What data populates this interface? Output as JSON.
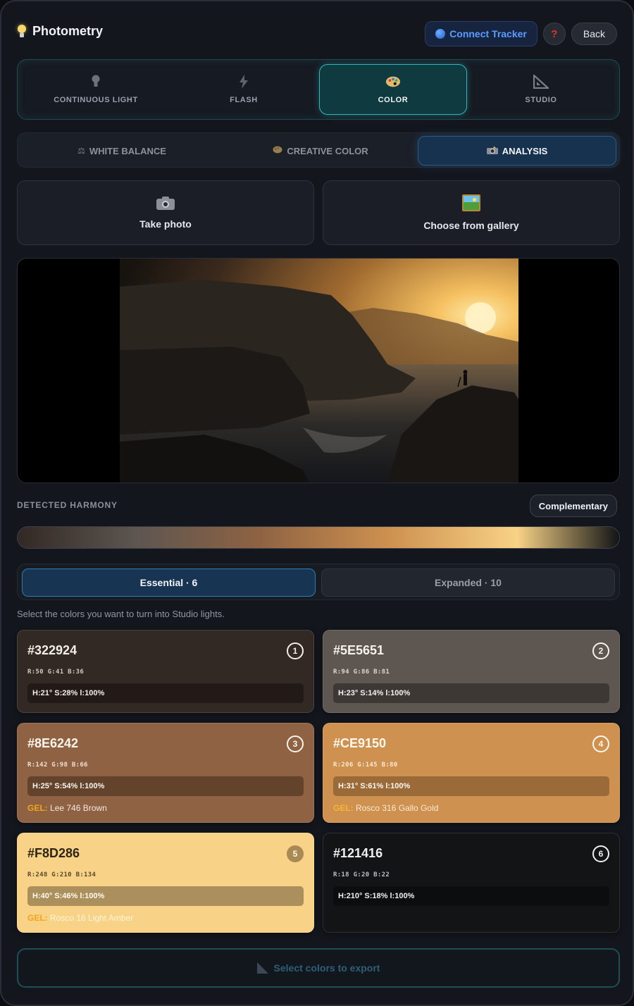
{
  "app": {
    "title": "Photometry"
  },
  "header": {
    "tracker_label": "Connect Tracker",
    "help_label": "?",
    "back_label": "Back"
  },
  "main_tabs": [
    {
      "label": "CONTINUOUS LIGHT",
      "icon": "bulb-icon"
    },
    {
      "label": "FLASH",
      "icon": "bolt-icon"
    },
    {
      "label": "COLOR",
      "icon": "palette-icon",
      "active": true
    },
    {
      "label": "STUDIO",
      "icon": "triangle-ruler-icon"
    }
  ],
  "sub_tabs": [
    {
      "label": "WHITE BALANCE",
      "icon": "scale-icon"
    },
    {
      "label": "CREATIVE COLOR",
      "icon": "palette-icon"
    },
    {
      "label": "ANALYSIS",
      "icon": "camera-flash-icon",
      "active": true
    }
  ],
  "capture": {
    "take_photo": "Take photo",
    "gallery": "Choose from gallery"
  },
  "harmony": {
    "label": "DETECTED HARMONY",
    "value": "Complementary"
  },
  "modes": {
    "essential": "Essential · 6",
    "expanded": "Expanded · 10",
    "active": "essential"
  },
  "hint": "Select the colors you want to turn into Studio lights.",
  "gel_key": "GEL:",
  "colors": [
    {
      "num": "1",
      "hex": "#322924",
      "rgb": "R:50  G:41  B:36",
      "hsl": "H:21° S:28% l:100%",
      "gel": ""
    },
    {
      "num": "2",
      "hex": "#5E5651",
      "rgb": "R:94  G:86  B:81",
      "hsl": "H:23° S:14% l:100%",
      "gel": ""
    },
    {
      "num": "3",
      "hex": "#8E6242",
      "rgb": "R:142  G:98  B:66",
      "hsl": "H:25° S:54% l:100%",
      "gel": "Lee 746 Brown"
    },
    {
      "num": "4",
      "hex": "#CE9150",
      "rgb": "R:206  G:145  B:80",
      "hsl": "H:31° S:61% l:100%",
      "gel": "Rosco 316 Gallo Gold"
    },
    {
      "num": "5",
      "hex": "#F8D286",
      "rgb": "R:248  G:210  B:134",
      "hsl": "H:40° S:46% l:100%",
      "gel": "Rosco 16 Light Amber"
    },
    {
      "num": "6",
      "hex": "#121416",
      "rgb": "R:18  G:20  B:22",
      "hsl": "H:210° S:18% l:100%",
      "gel": ""
    }
  ],
  "export_label": "Select colors to export",
  "accent": {
    "teal": "#2fb7bf",
    "blue": "#5a9cff",
    "gel": "#f5a51a"
  }
}
